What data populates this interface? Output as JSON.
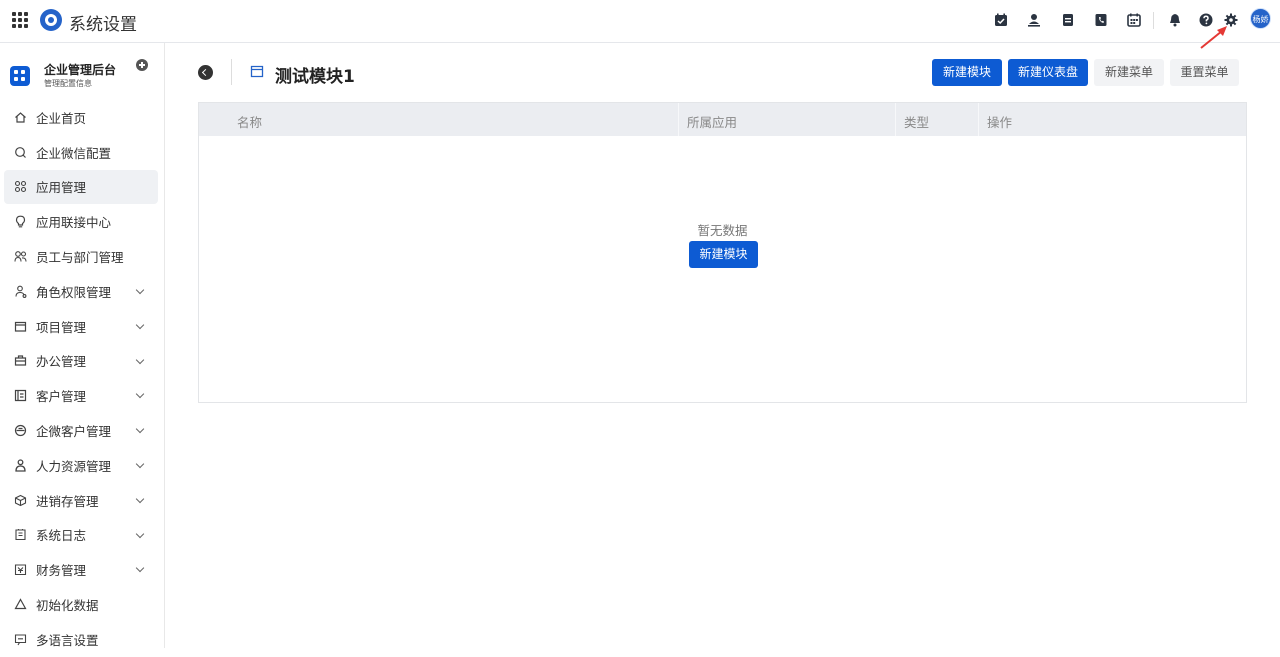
{
  "topbar": {
    "title": "系统设置",
    "avatar_text": "杨娇"
  },
  "sidebar": {
    "org_name": "企业管理后台",
    "org_subtitle": "管理配置信息",
    "items": [
      {
        "label": "企业首页",
        "icon": "home-icon",
        "expandable": false
      },
      {
        "label": "企业微信配置",
        "icon": "chat-icon",
        "expandable": false
      },
      {
        "label": "应用管理",
        "icon": "apps-grid-icon",
        "expandable": false,
        "active": true
      },
      {
        "label": "应用联接中心",
        "icon": "bulb-icon",
        "expandable": false
      },
      {
        "label": "员工与部门管理",
        "icon": "users-icon",
        "expandable": false
      },
      {
        "label": "角色权限管理",
        "icon": "role-icon",
        "expandable": true
      },
      {
        "label": "项目管理",
        "icon": "folder-icon",
        "expandable": true
      },
      {
        "label": "办公管理",
        "icon": "briefcase-icon",
        "expandable": true
      },
      {
        "label": "客户管理",
        "icon": "contacts-icon",
        "expandable": true
      },
      {
        "label": "企微客户管理",
        "icon": "wecom-icon",
        "expandable": true
      },
      {
        "label": "人力资源管理",
        "icon": "person-icon",
        "expandable": true
      },
      {
        "label": "进销存管理",
        "icon": "box-icon",
        "expandable": true
      },
      {
        "label": "系统日志",
        "icon": "log-icon",
        "expandable": true
      },
      {
        "label": "财务管理",
        "icon": "finance-icon",
        "expandable": true
      },
      {
        "label": "初始化数据",
        "icon": "recycle-icon",
        "expandable": false
      },
      {
        "label": "多语言设置",
        "icon": "language-icon",
        "expandable": false
      }
    ]
  },
  "main": {
    "title": "测试模块1",
    "buttons": {
      "new_module": "新建模块",
      "new_dashboard": "新建仪表盘",
      "new_menu": "新建菜单",
      "reset_menu": "重置菜单"
    },
    "table": {
      "columns": [
        "名称",
        "所属应用",
        "类型",
        "操作"
      ],
      "rows": [],
      "empty_text": "暂无数据",
      "empty_button": "新建模块"
    }
  },
  "colors": {
    "primary": "#0d5bd3",
    "annotation_arrow": "#e53935"
  }
}
